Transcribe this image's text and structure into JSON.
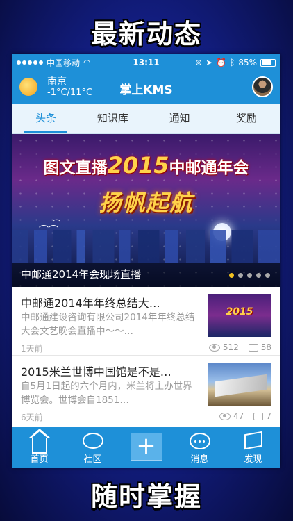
{
  "promo": {
    "top": "最新动态",
    "bottom": "随时掌握"
  },
  "status_bar": {
    "carrier": "中国移动",
    "time": "13:11",
    "battery": "85%",
    "battery_level": 0.85
  },
  "header": {
    "city": "南京",
    "temperature": "-1°C/11°C",
    "title": "掌上KMS",
    "weather_icon": "sun-icon"
  },
  "tabs": [
    {
      "label": "头条",
      "active": true
    },
    {
      "label": "知识库",
      "active": false
    },
    {
      "label": "通知",
      "active": false
    },
    {
      "label": "奖励",
      "active": false
    }
  ],
  "banner": {
    "headline_left": "图文直播",
    "headline_year": "2015",
    "headline_right": "中邮通年会",
    "slogan": "扬帆起航",
    "caption": "中邮通2014年会现场直播",
    "dots": 5,
    "active_dot": 0
  },
  "news": [
    {
      "title": "中邮通2014年年终总结大…",
      "summary": "中邮通建设咨询有限公司2014年年终总结大会文艺晚会直播中～～…",
      "time": "1天前",
      "views": "512",
      "comments": "58",
      "thumb_text": "2015"
    },
    {
      "title": "2015米兰世博中国馆是不是…",
      "summary": "自5月1日起的六个月内，米兰将主办世界博览会。世博会自1851…",
      "time": "6天前",
      "views": "47",
      "comments": "7"
    }
  ],
  "bottom_nav": [
    {
      "label": "首页",
      "icon": "home-icon"
    },
    {
      "label": "社区",
      "icon": "chat-bubble-icon"
    },
    {
      "label": "",
      "icon": "plus-icon"
    },
    {
      "label": "消息",
      "icon": "message-icon"
    },
    {
      "label": "发现",
      "icon": "flag-icon"
    }
  ],
  "colors": {
    "brand": "#1e90d8",
    "accent": "#f0c020",
    "muted": "#999999"
  }
}
